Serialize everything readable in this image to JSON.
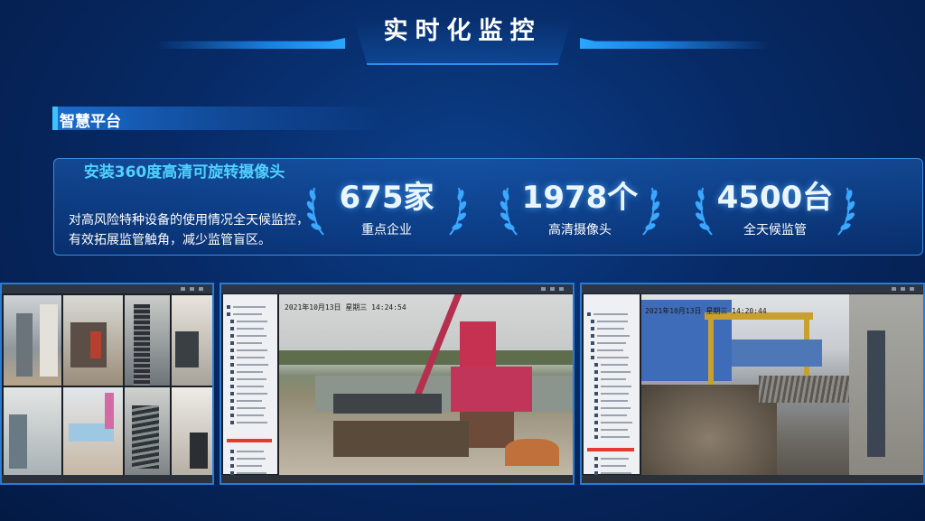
{
  "title": "实时化监控",
  "section": "智慧平台",
  "panel": {
    "heading": "安装360度高清可旋转摄像头",
    "description": "对高风险特种设备的使用情况全天候监控，有效拓展监管触角，减少监管盲区。"
  },
  "stats": [
    {
      "value": "675家",
      "label": "重点企业"
    },
    {
      "value": "1978个",
      "label": "高清摄像头"
    },
    {
      "value": "4500台",
      "label": "全天候监管"
    }
  ],
  "monitors": {
    "crane": {
      "timestamp": "2021年10月13日  星期三  14:24:54"
    },
    "yard": {
      "timestamp": "2021年10月13日  星期三  14:20:44"
    }
  },
  "icons": [
    "laurel-left-icon",
    "laurel-right-icon"
  ],
  "colors": {
    "accent": "#4fd2ff",
    "panel_border": "#3a8de0",
    "selected_row": "#e53a2f"
  }
}
